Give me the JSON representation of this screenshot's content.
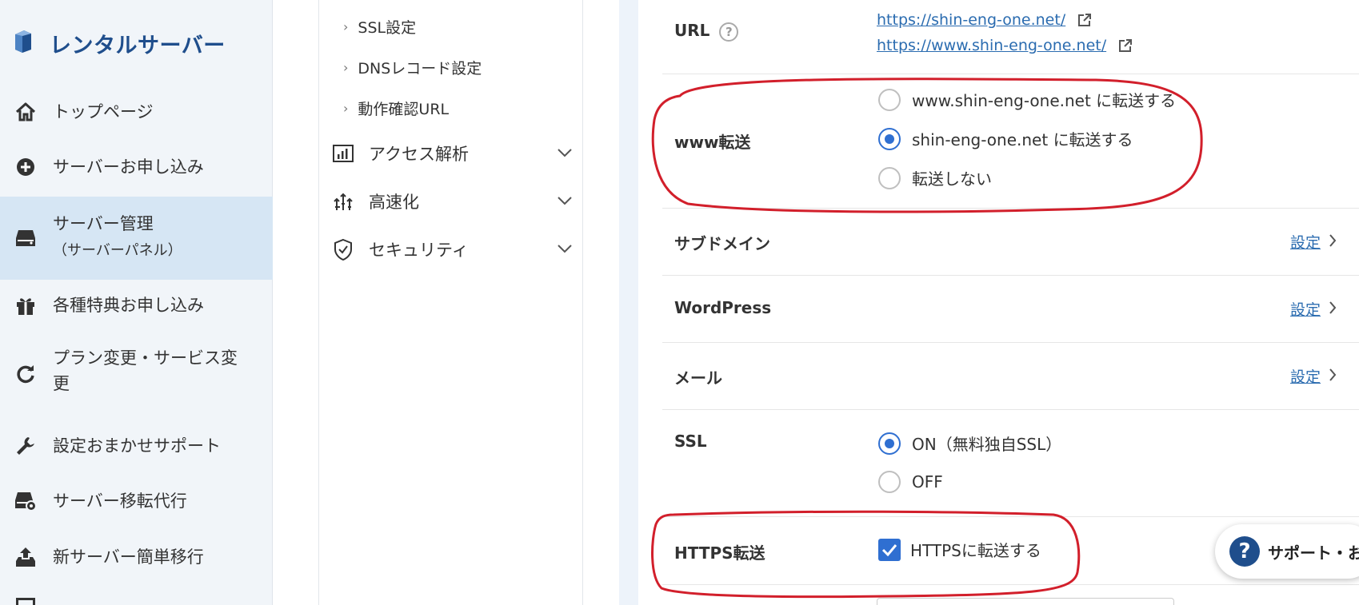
{
  "brand": {
    "title": "レンタルサーバー"
  },
  "sidebar": {
    "items": [
      {
        "label": "トップページ",
        "icon": "home-icon"
      },
      {
        "label": "サーバーお申し込み",
        "icon": "plus-circle-icon"
      },
      {
        "label": "サーバー管理",
        "sublabel": "（サーバーパネル）",
        "icon": "server-icon",
        "active": true
      },
      {
        "label": "各種特典お申し込み",
        "icon": "gift-icon"
      },
      {
        "label": "プラン変更・サービス変",
        "label2": "更",
        "icon": "refresh-icon"
      },
      {
        "label": "設定おまかせサポート",
        "icon": "wrench-icon"
      },
      {
        "label": "サーバー移転代行",
        "icon": "server-transfer-icon"
      },
      {
        "label": "新サーバー簡単移行",
        "icon": "upload-server-icon"
      }
    ]
  },
  "subnav": {
    "links": [
      "SSL設定",
      "DNSレコード設定",
      "動作確認URL"
    ],
    "groups": [
      {
        "label": "アクセス解析",
        "icon": "bar-chart-icon"
      },
      {
        "label": "高速化",
        "icon": "speed-arrows-icon"
      },
      {
        "label": "セキュリティ",
        "icon": "shield-icon"
      }
    ]
  },
  "main": {
    "url": {
      "label": "URL",
      "help": "?",
      "links": [
        "https://shin-eng-one.net/",
        "https://www.shin-eng-one.net/"
      ]
    },
    "www": {
      "label": "www転送",
      "options": [
        {
          "label": "www.shin-eng-one.net に転送する",
          "selected": false
        },
        {
          "label": "shin-eng-one.net に転送する",
          "selected": true
        },
        {
          "label": "転送しない",
          "selected": false
        }
      ]
    },
    "subdomain": {
      "label": "サブドメイン",
      "action": "設定"
    },
    "wordpress": {
      "label": "WordPress",
      "action": "設定"
    },
    "mail": {
      "label": "メール",
      "action": "設定"
    },
    "ssl": {
      "label": "SSL",
      "options": [
        {
          "label": "ON（無料独自SSL）",
          "selected": true
        },
        {
          "label": "OFF",
          "selected": false
        }
      ]
    },
    "https": {
      "label": "HTTPS転送",
      "checkbox_label": "HTTPSに転送する",
      "checked": true
    }
  },
  "support": {
    "label": "サポート・お",
    "icon": "?"
  },
  "colors": {
    "accent": "#2f6fd1",
    "brand": "#1f4e8c",
    "highlight": "#d21f2b",
    "active_bg": "#d6e6f4"
  }
}
